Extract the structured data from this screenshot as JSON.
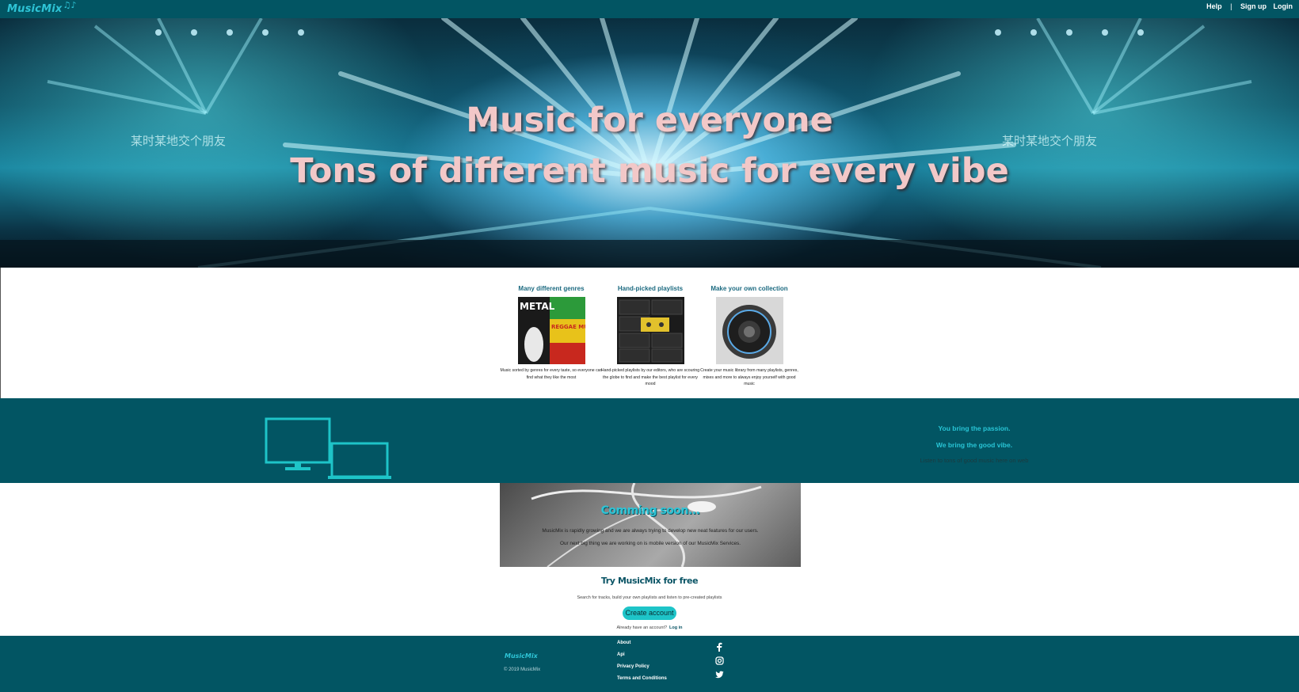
{
  "header": {
    "logo": "MusicMix",
    "logo_notes": "♫♪",
    "nav": {
      "help": "Help",
      "separator": "|",
      "signup": "Sign up",
      "login": "Login"
    }
  },
  "hero": {
    "title": "Music for everyone",
    "subtitle": "Tons of different music for every vibe",
    "banner_text_left": "某时某地交个朋友",
    "banner_text_right": "某时某地交个朋友"
  },
  "features": [
    {
      "title": "Many different genres",
      "image": "genre-collage",
      "image_text_1": "METAL",
      "image_text_2": "REGGAE MUSIC",
      "text": "Music sorted by genres for every taste, so everyone can find what they like the most"
    },
    {
      "title": "Hand-picked playlists",
      "image": "cassette-tapes",
      "text": "Hand-picked playlists by our editors, who are scouring the globe to find and make the best playlist for every mood"
    },
    {
      "title": "Make your own collection",
      "image": "speaker",
      "text": "Create your music library from many playlists, genres, mixes and more to always enjoy yourself with good music"
    }
  ],
  "promo_band": {
    "line1": "You bring the passion.",
    "line2": "We bring the good vibe.",
    "line3": "Listen to tons of good music here on web",
    "icon": "devices-icon"
  },
  "coming_soon": {
    "title": "Comming soon...",
    "line1": "MusicMix is rapidly growing and we are always trying to develop new neat features for our users.",
    "line2": "Our next big thing we are working on is mobile version of our MusicMix Services."
  },
  "try_free": {
    "title": "Try MusicMix for free",
    "desc": "Search for tracks, build your own playlists and listen to pre-created playlists",
    "button": "Create account",
    "already": "Already have an account?",
    "login": "Log in"
  },
  "footer": {
    "logo": "MusicMix",
    "copyright": "© 2019 MusicMix",
    "links": [
      "About",
      "Api",
      "Privacy Policy",
      "Terms and Conditions"
    ],
    "social": [
      "facebook-icon",
      "instagram-icon",
      "twitter-icon"
    ]
  },
  "colors": {
    "brand_dark": "#025563",
    "brand_accent": "#2ec4d6",
    "button": "#1ec4c8",
    "hero_text": "#f2c8c8"
  }
}
